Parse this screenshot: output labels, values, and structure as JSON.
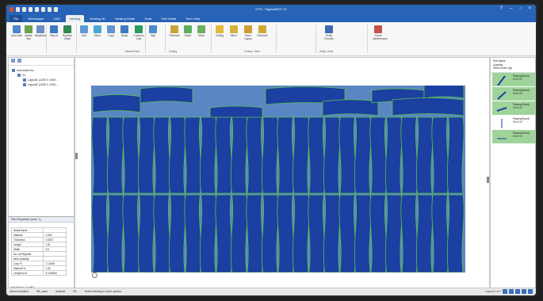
{
  "window": {
    "title": "CFG - SigmaNEST 10"
  },
  "tabs": [
    "File",
    "Workspace",
    "CAD",
    "Nesting",
    "Nesting 3D",
    "Nesting Detail",
    "Tools",
    "Part Detail",
    "Tech Help"
  ],
  "active_tab": "Nesting",
  "ribbon": {
    "buttons": [
      {
        "label": "Auto Nest",
        "color": "#4a86c9"
      },
      {
        "label": "Nester Tool",
        "color": "#6aa14a"
      },
      {
        "label": "NestAssist",
        "color": "#6b8fc8"
      },
      {
        "label": "Report",
        "color": "#3c78c4"
      },
      {
        "label": "Replace Sheet",
        "color": "#2f8a4e"
      },
      {
        "label": "Edit",
        "color": "#5e9ad4"
      },
      {
        "label": "Mirror",
        "color": "#4ea6d8"
      },
      {
        "label": "Copy",
        "color": "#5f95d0"
      },
      {
        "label": "Bump",
        "color": "#3f7cc0"
      },
      {
        "label": "Common Cuts",
        "color": "#2d9b5b"
      },
      {
        "label": "Skip",
        "color": "#4a8dd0"
      },
      {
        "label": "Remnant",
        "color": "#c8a33a"
      },
      {
        "label": "Sheet",
        "color": "#5cae5a"
      },
      {
        "label": "Move",
        "color": "#6fae63"
      },
      {
        "label": "Cutting",
        "color": "#e1bb38"
      },
      {
        "label": "Mirror",
        "color": "#d6b33c"
      },
      {
        "label": "Move Layout",
        "color": "#cf9c39"
      },
      {
        "label": "Remnant",
        "color": "#d1a933"
      },
      {
        "label": "Verify Process",
        "color": "#3c6ab3"
      },
      {
        "label": "Check Interferences",
        "color": "#c4544b"
      }
    ],
    "groups": [
      "Manual Nest",
      "Cutting",
      "X-Ness / Nest",
      "Verify / Nest"
    ]
  },
  "left_panel": {
    "tree": [
      {
        "label": "nest-sheet.hc",
        "level": 0
      },
      {
        "label": "S1",
        "level": 1
      },
      {
        "label": "Layout1 (1200 X 1000 ...",
        "level": 2
      },
      {
        "label": "Layout2 (1200 X 1000 ...",
        "level": 2
      }
    ],
    "properties_title": "Part Properties (ninc: 1)",
    "properties": [
      [
        "Detail Name",
        ""
      ],
      [
        "Material",
        "1.505"
      ],
      [
        "Thickness",
        "0.0537"
      ],
      [
        "Length",
        "1.91"
      ],
      [
        "Width",
        "3.8"
      ],
      [
        "No. of Required",
        ""
      ],
      [
        "Nest Quantity",
        ""
      ],
      [
        "Loop %",
        "7.12408"
      ],
      [
        "Material %",
        "1.06"
      ],
      [
        "Length to Al",
        "3.4 A/5/60"
      ]
    ],
    "footer": "Unit sheet ip_to eff00"
  },
  "right_panel": {
    "header": [
      "Part Name",
      "Quantity",
      "Sheet Order Qty"
    ],
    "parts": [
      {
        "name": "Plasma(Grant)",
        "qty": "20 of 20"
      },
      {
        "name": "Plasma(Grant)",
        "qty": "20 of 20"
      },
      {
        "name": "Plasma(Grant)",
        "qty": "20 of 20"
      },
      {
        "name": "Plasma(Grant)",
        "qty": "20 of 20"
      },
      {
        "name": "Plasma(Grant)",
        "qty": "20 of 20"
      }
    ]
  },
  "statusbar": {
    "items": [
      "Admin workflow",
      "SB_sawe",
      "material",
      "SS",
      "Select Nesting is insert options"
    ],
    "right_text": "Layout 1 of 2"
  },
  "colors": {
    "accent": "#2763b6",
    "sheet": "#5b86c4",
    "part_fill": "#1c3fa2",
    "part_outline": "#55c24c",
    "part_highlight": "#9fd39a"
  }
}
